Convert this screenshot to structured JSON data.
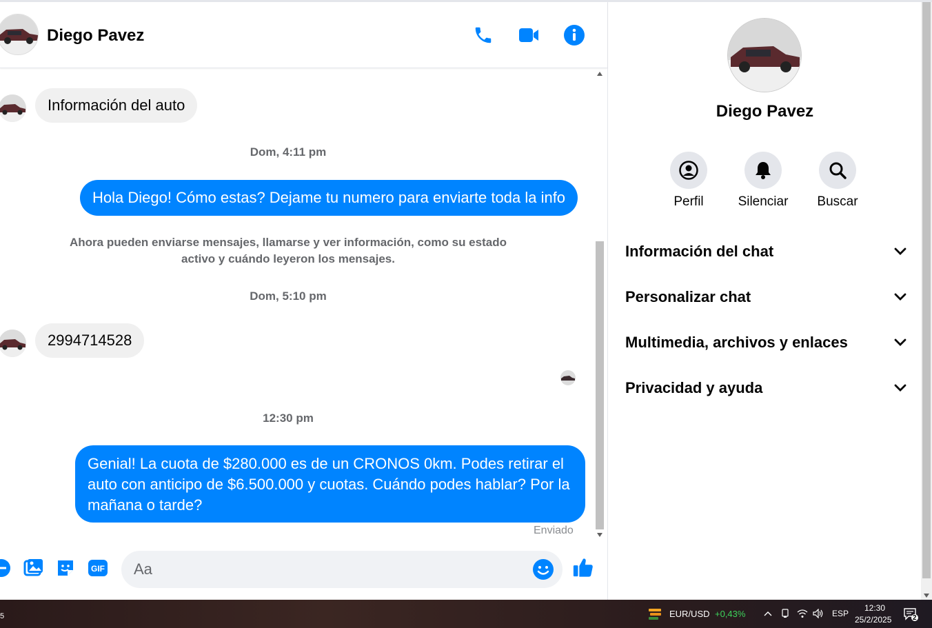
{
  "contact": {
    "name": "Diego Pavez"
  },
  "messages": {
    "incoming_1": "Información del auto",
    "timestamp_1": "Dom, 4:11 pm",
    "outgoing_1": "Hola Diego! Cómo estas? Dejame tu numero para enviarte toda la info",
    "system_notice": "Ahora pueden enviarse mensajes, llamarse y ver información, como su estado activo y cuándo leyeron los mensajes.",
    "timestamp_2": "Dom, 5:10 pm",
    "incoming_2": "2994714528",
    "timestamp_3": "12:30 pm",
    "outgoing_2": "Genial! La cuota de $280.000 es de un CRONOS 0km. Podes retirar el auto con anticipo de $6.500.000 y cuotas. Cuándo podes hablar? Por la mañana o tarde?",
    "sent_status": "Enviado"
  },
  "composer": {
    "placeholder": "Aa",
    "gif_label": "GIF"
  },
  "panel": {
    "name": "Diego Pavez",
    "actions": [
      "Perfil",
      "Silenciar",
      "Buscar"
    ],
    "sections": [
      "Información del chat",
      "Personalizar chat",
      "Multimedia, archivos y enlaces",
      "Privacidad y ayuda"
    ]
  },
  "taskbar": {
    "ticker_symbol": "EUR/USD",
    "ticker_change": "+0,43%",
    "language": "ESP",
    "time": "12:30",
    "date": "25/2/2025",
    "notification_count": "2",
    "left_badge": "5"
  },
  "colors": {
    "accent": "#0084ff",
    "bubble_in": "#f0f0f0",
    "ticker_up": "#3dd45b"
  }
}
